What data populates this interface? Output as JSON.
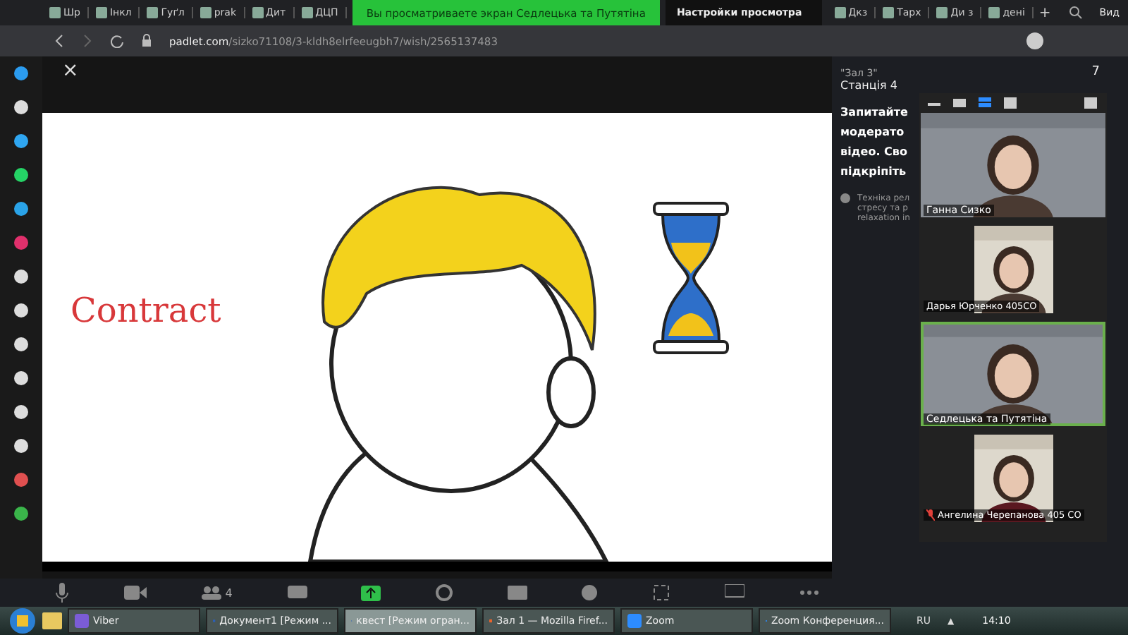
{
  "browser": {
    "tabs": [
      "Шр",
      "Інкл",
      "Гуґл",
      "prak",
      "Дит",
      "ДЦП"
    ],
    "tabs_right": [
      "Дкз",
      "Тарх",
      "Ди з",
      "дені"
    ],
    "share_banner": "Вы просматриваете экран Седлецька та Путятіна",
    "view_options": "Настройки просмотра",
    "new_tab": "+",
    "view_label": "Вид",
    "url_host": "padlet.com",
    "url_path": "/sizko71108/3-kldh8elrfeeugbh7/wish/2565137483"
  },
  "post": {
    "close": "×",
    "caption": "Contract"
  },
  "side_panel": {
    "room": "\"Зал 3\"",
    "station": "Станція 4",
    "heading_lines": [
      "Запитайте",
      "модерато",
      "відео. Сво",
      "підкріпіть"
    ],
    "note_lines": [
      "Техніка рел",
      "стресу та р",
      "relaxation in"
    ],
    "counter": "7"
  },
  "zoom_panel": {
    "tiles": [
      {
        "name": "Ганна Сизко",
        "speaking": false,
        "muted": false,
        "kind": "wide"
      },
      {
        "name": "Дарья Юрченко 405СО",
        "speaking": false,
        "muted": false,
        "kind": "narrow"
      },
      {
        "name": "Седлецька та Путятіна",
        "speaking": true,
        "muted": false,
        "kind": "wide"
      },
      {
        "name": "Ангелина Черепанова 405 СО",
        "speaking": false,
        "muted": true,
        "kind": "narrow"
      }
    ]
  },
  "meeting_toolbar": {
    "participants": "4"
  },
  "taskbar": {
    "items": [
      {
        "label": "Viber",
        "kind": "viber",
        "selected": false
      },
      {
        "label": "Документ1 [Режим ...",
        "kind": "word",
        "selected": false
      },
      {
        "label": "квест [Режим огран...",
        "kind": "word",
        "selected": true
      },
      {
        "label": "Зал 1 — Mozilla Firef...",
        "kind": "firefox",
        "selected": false
      },
      {
        "label": "Zoom",
        "kind": "zoom",
        "selected": false
      },
      {
        "label": "Zoom Конференция...",
        "kind": "zoom",
        "selected": false
      }
    ],
    "lang": "RU",
    "tray": "▲",
    "time": "14:10"
  }
}
